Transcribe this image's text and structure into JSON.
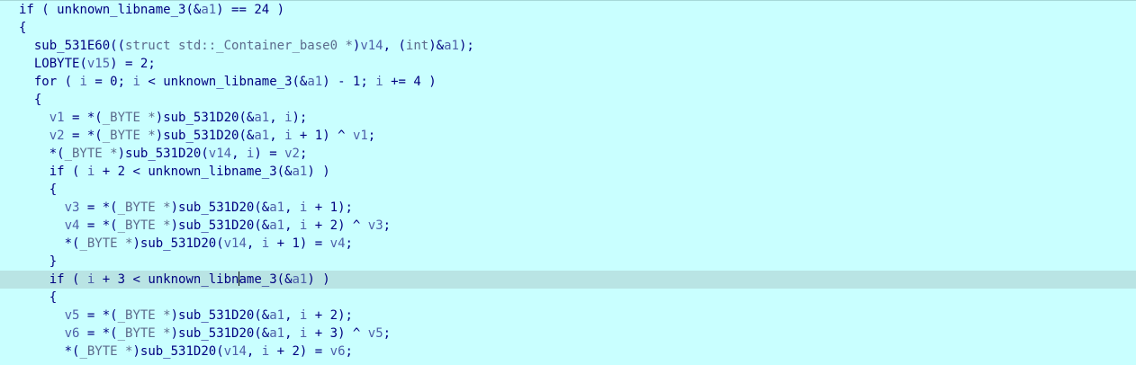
{
  "editor": {
    "caret": {
      "line": 15,
      "after_chars": 25
    },
    "lines": [
      {
        "indent": 0,
        "tokens": [
          [
            "kw",
            "if ( "
          ],
          [
            "fn",
            "unknown_libname_3"
          ],
          [
            "plain",
            "(&"
          ],
          [
            "var",
            "a1"
          ],
          [
            "plain",
            ") == 24 )"
          ]
        ]
      },
      {
        "indent": 0,
        "tokens": [
          [
            "plain",
            "{"
          ]
        ]
      },
      {
        "indent": 2,
        "tokens": [
          [
            "fn",
            "sub_531E60"
          ],
          [
            "plain",
            "(("
          ],
          [
            "type",
            "struct std::_Container_base0 *"
          ],
          [
            "plain",
            ")"
          ],
          [
            "var",
            "v14"
          ],
          [
            "plain",
            ", ("
          ],
          [
            "type",
            "int"
          ],
          [
            "plain",
            ")&"
          ],
          [
            "var",
            "a1"
          ],
          [
            "plain",
            ");"
          ]
        ]
      },
      {
        "indent": 2,
        "tokens": [
          [
            "fn",
            "LOBYTE"
          ],
          [
            "plain",
            "("
          ],
          [
            "var",
            "v15"
          ],
          [
            "plain",
            ") = 2;"
          ]
        ]
      },
      {
        "indent": 2,
        "tokens": [
          [
            "kw",
            "for"
          ],
          [
            "plain",
            " ( "
          ],
          [
            "var",
            "i"
          ],
          [
            "plain",
            " = 0; "
          ],
          [
            "var",
            "i"
          ],
          [
            "plain",
            " < "
          ],
          [
            "fn",
            "unknown_libname_3"
          ],
          [
            "plain",
            "(&"
          ],
          [
            "var",
            "a1"
          ],
          [
            "plain",
            ") - 1; "
          ],
          [
            "var",
            "i"
          ],
          [
            "plain",
            " += 4 )"
          ]
        ]
      },
      {
        "indent": 2,
        "tokens": [
          [
            "plain",
            "{"
          ]
        ]
      },
      {
        "indent": 4,
        "tokens": [
          [
            "var",
            "v1"
          ],
          [
            "plain",
            " = *("
          ],
          [
            "type",
            "_BYTE *"
          ],
          [
            "plain",
            ")"
          ],
          [
            "fn",
            "sub_531D20"
          ],
          [
            "plain",
            "(&"
          ],
          [
            "var",
            "a1"
          ],
          [
            "plain",
            ", "
          ],
          [
            "var",
            "i"
          ],
          [
            "plain",
            ");"
          ]
        ]
      },
      {
        "indent": 4,
        "tokens": [
          [
            "var",
            "v2"
          ],
          [
            "plain",
            " = *("
          ],
          [
            "type",
            "_BYTE *"
          ],
          [
            "plain",
            ")"
          ],
          [
            "fn",
            "sub_531D20"
          ],
          [
            "plain",
            "(&"
          ],
          [
            "var",
            "a1"
          ],
          [
            "plain",
            ", "
          ],
          [
            "var",
            "i"
          ],
          [
            "plain",
            " + 1) ^ "
          ],
          [
            "var",
            "v1"
          ],
          [
            "plain",
            ";"
          ]
        ]
      },
      {
        "indent": 4,
        "tokens": [
          [
            "plain",
            "*("
          ],
          [
            "type",
            "_BYTE *"
          ],
          [
            "plain",
            ")"
          ],
          [
            "fn",
            "sub_531D20"
          ],
          [
            "plain",
            "("
          ],
          [
            "var",
            "v14"
          ],
          [
            "plain",
            ", "
          ],
          [
            "var",
            "i"
          ],
          [
            "plain",
            ") = "
          ],
          [
            "var",
            "v2"
          ],
          [
            "plain",
            ";"
          ]
        ]
      },
      {
        "indent": 4,
        "tokens": [
          [
            "kw",
            "if"
          ],
          [
            "plain",
            " ( "
          ],
          [
            "var",
            "i"
          ],
          [
            "plain",
            " + 2 < "
          ],
          [
            "fn",
            "unknown_libname_3"
          ],
          [
            "plain",
            "(&"
          ],
          [
            "var",
            "a1"
          ],
          [
            "plain",
            ") )"
          ]
        ]
      },
      {
        "indent": 4,
        "tokens": [
          [
            "plain",
            "{"
          ]
        ]
      },
      {
        "indent": 6,
        "tokens": [
          [
            "var",
            "v3"
          ],
          [
            "plain",
            " = *("
          ],
          [
            "type",
            "_BYTE *"
          ],
          [
            "plain",
            ")"
          ],
          [
            "fn",
            "sub_531D20"
          ],
          [
            "plain",
            "(&"
          ],
          [
            "var",
            "a1"
          ],
          [
            "plain",
            ", "
          ],
          [
            "var",
            "i"
          ],
          [
            "plain",
            " + 1);"
          ]
        ]
      },
      {
        "indent": 6,
        "tokens": [
          [
            "var",
            "v4"
          ],
          [
            "plain",
            " = *("
          ],
          [
            "type",
            "_BYTE *"
          ],
          [
            "plain",
            ")"
          ],
          [
            "fn",
            "sub_531D20"
          ],
          [
            "plain",
            "(&"
          ],
          [
            "var",
            "a1"
          ],
          [
            "plain",
            ", "
          ],
          [
            "var",
            "i"
          ],
          [
            "plain",
            " + 2) ^ "
          ],
          [
            "var",
            "v3"
          ],
          [
            "plain",
            ";"
          ]
        ]
      },
      {
        "indent": 6,
        "tokens": [
          [
            "plain",
            "*("
          ],
          [
            "type",
            "_BYTE *"
          ],
          [
            "plain",
            ")"
          ],
          [
            "fn",
            "sub_531D20"
          ],
          [
            "plain",
            "("
          ],
          [
            "var",
            "v14"
          ],
          [
            "plain",
            ", "
          ],
          [
            "var",
            "i"
          ],
          [
            "plain",
            " + 1) = "
          ],
          [
            "var",
            "v4"
          ],
          [
            "plain",
            ";"
          ]
        ]
      },
      {
        "indent": 4,
        "tokens": [
          [
            "plain",
            "}"
          ]
        ]
      },
      {
        "indent": 4,
        "current": true,
        "tokens": [
          [
            "kw",
            "if"
          ],
          [
            "plain",
            " ( "
          ],
          [
            "var",
            "i"
          ],
          [
            "plain",
            " + 3 < "
          ],
          [
            "fn",
            "unknown_libname_3"
          ],
          [
            "plain",
            "(&"
          ],
          [
            "var",
            "a1"
          ],
          [
            "plain",
            ") )"
          ]
        ]
      },
      {
        "indent": 4,
        "tokens": [
          [
            "plain",
            "{"
          ]
        ]
      },
      {
        "indent": 6,
        "tokens": [
          [
            "var",
            "v5"
          ],
          [
            "plain",
            " = *("
          ],
          [
            "type",
            "_BYTE *"
          ],
          [
            "plain",
            ")"
          ],
          [
            "fn",
            "sub_531D20"
          ],
          [
            "plain",
            "(&"
          ],
          [
            "var",
            "a1"
          ],
          [
            "plain",
            ", "
          ],
          [
            "var",
            "i"
          ],
          [
            "plain",
            " + 2);"
          ]
        ]
      },
      {
        "indent": 6,
        "tokens": [
          [
            "var",
            "v6"
          ],
          [
            "plain",
            " = *("
          ],
          [
            "type",
            "_BYTE *"
          ],
          [
            "plain",
            ")"
          ],
          [
            "fn",
            "sub_531D20"
          ],
          [
            "plain",
            "(&"
          ],
          [
            "var",
            "a1"
          ],
          [
            "plain",
            ", "
          ],
          [
            "var",
            "i"
          ],
          [
            "plain",
            " + 3) ^ "
          ],
          [
            "var",
            "v5"
          ],
          [
            "plain",
            ";"
          ]
        ]
      },
      {
        "indent": 6,
        "tokens": [
          [
            "plain",
            "*("
          ],
          [
            "type",
            "_BYTE *"
          ],
          [
            "plain",
            ")"
          ],
          [
            "fn",
            "sub_531D20"
          ],
          [
            "plain",
            "("
          ],
          [
            "var",
            "v14"
          ],
          [
            "plain",
            ", "
          ],
          [
            "var",
            "i"
          ],
          [
            "plain",
            " + 2) = "
          ],
          [
            "var",
            "v6"
          ],
          [
            "plain",
            ";"
          ]
        ]
      }
    ]
  }
}
